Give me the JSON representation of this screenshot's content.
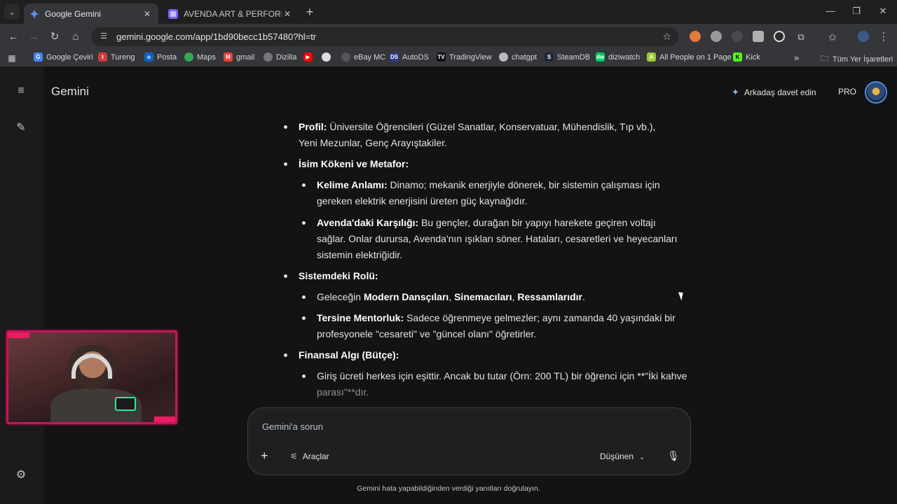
{
  "browser": {
    "tabs": [
      {
        "title": "Google Gemini",
        "active": true,
        "icon": "gemini-spark-icon"
      },
      {
        "title": "AVENDA ART & PERFORMANCE",
        "active": false,
        "icon": "avenda-icon"
      }
    ],
    "url": "gemini.google.com/app/1bd90becc1b57480?hl=tr",
    "bookmarks": [
      "Google Çeviri",
      "Tureng",
      "Posta",
      "Maps",
      "gmail",
      "Dizilla",
      "",
      "",
      "eBay MC",
      "AutoDS",
      "TradingView",
      "chatgpt",
      "SteamDB",
      "diziwatch",
      "All People on 1 Page",
      "Kick"
    ],
    "bookmarks_folder": "Tüm Yer İşaretleri"
  },
  "app": {
    "brand": "Gemini",
    "invite": "Arkadaş davet edin",
    "plan_badge": "PRO"
  },
  "response": {
    "profil_label": "Profil:",
    "profil_text": "Üniversite Öğrencileri (Güzel Sanatlar, Konservatuar, Mühendislik, Tıp vb.), Yeni Mezunlar, Genç Arayıştakiler.",
    "isim_heading": "İsim Kökeni ve Metafor:",
    "kelime_label": "Kelime Anlamı:",
    "kelime_text": "Dinamo; mekanik enerjiyle dönerek, bir sistemin çalışması için gereken elektrik enerjisini üreten güç kaynağıdır.",
    "avenda_label": "Avenda'daki Karşılığı:",
    "avenda_text": "Bu gençler, durağan bir yapıyı harekete geçiren voltajı sağlar. Onlar durursa, Avenda'nın ışıkları söner. Hataları, cesaretleri ve heyecanları sistemin elektriğidir.",
    "rol_heading": "Sistemdeki Rolü:",
    "gelecek_prefix": "Geleceğin ",
    "gelecek_b1": "Modern Dansçıları",
    "gelecek_sep1": ", ",
    "gelecek_b2": "Sinemacıları",
    "gelecek_sep2": ", ",
    "gelecek_b3": "Ressamlarıdır",
    "gelecek_suffix": ".",
    "tersine_label": "Tersine Mentorluk:",
    "tersine_text": "Sadece öğrenmeye gelmezler; aynı zamanda 40 yaşındaki bir profesyonele \"cesareti\" ve \"güncel olanı\" öğretirler.",
    "finans_heading": "Finansal Algı (Bütçe):",
    "giris_line1": "Giriş ücreti herkes için eşittir. Ancak bu tutar (Örn: 200 TL) bir öğrenci için **\"İki kahve",
    "giris_line2": "parası\"**dır."
  },
  "composer": {
    "placeholder": "Gemini'a sorun",
    "tools_label": "Araçlar",
    "mode_label": "Düşünen"
  },
  "disclaimer": "Gemini hata yapabildiğinden verdiği yanıtları doğrulayın."
}
